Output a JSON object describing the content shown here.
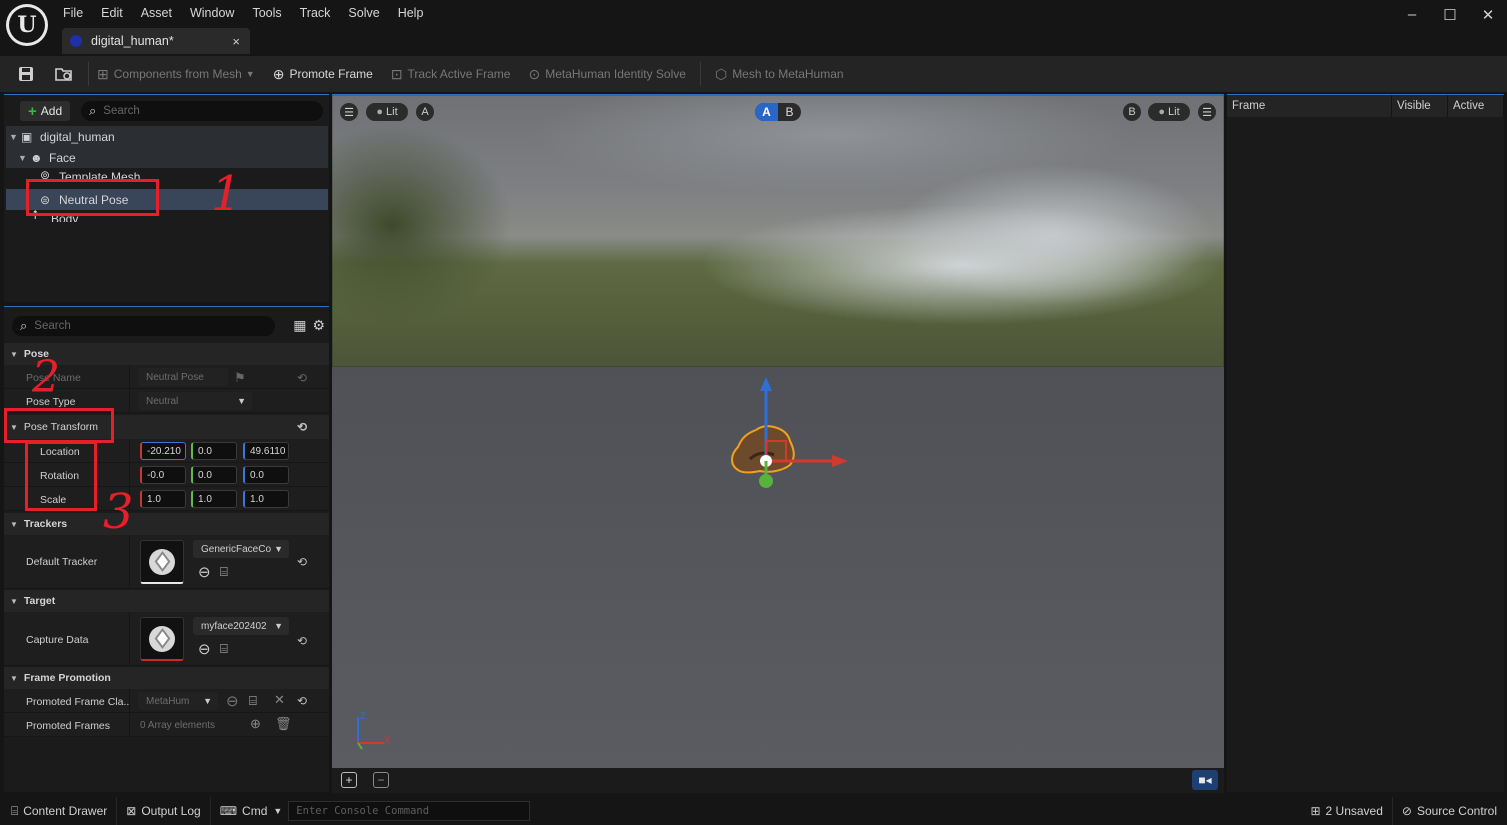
{
  "app": {
    "logo": "U",
    "menu": [
      "File",
      "Edit",
      "Asset",
      "Window",
      "Tools",
      "Track",
      "Solve",
      "Help"
    ],
    "tab_title": "digital_human*",
    "tab_close": "×",
    "window_controls": [
      "–",
      "☐",
      "✕"
    ]
  },
  "toolbar": {
    "save_icon": "save-icon",
    "browse_icon": "browse-icon",
    "buttons": [
      {
        "label": "Components from Mesh",
        "enabled": false,
        "icon": "components-icon"
      },
      {
        "label": "Promote Frame",
        "enabled": true,
        "icon": "plus-square-icon"
      },
      {
        "label": "Track Active Frame",
        "enabled": false,
        "icon": "track-icon"
      },
      {
        "label": "MetaHuman Identity Solve",
        "enabled": false,
        "icon": "solve-icon"
      },
      {
        "label": "Mesh to MetaHuman",
        "enabled": false,
        "icon": "cube-icon"
      }
    ]
  },
  "components": {
    "add_label": "Add",
    "search_placeholder": "Search",
    "tree": [
      "digital_human",
      "Face",
      "Template Mesh",
      "Neutral Pose",
      "Body"
    ]
  },
  "details": {
    "search_placeholder": "Search",
    "sections": {
      "pose": "Pose",
      "pose_transform": "Pose Transform",
      "trackers": "Trackers",
      "target": "Target",
      "frame_promotion": "Frame Promotion"
    },
    "pose_name_label": "Pose Name",
    "pose_name_value": "Neutral Pose",
    "pose_type_label": "Pose Type",
    "pose_type_value": "Neutral",
    "location_label": "Location",
    "location": [
      "-20.210",
      "0.0",
      "49.6110"
    ],
    "rotation_label": "Rotation",
    "rotation": [
      "-0.0",
      "0.0",
      "0.0"
    ],
    "scale_label": "Scale",
    "scale": [
      "1.0",
      "1.0",
      "1.0"
    ],
    "default_tracker_label": "Default Tracker",
    "default_tracker_value": "GenericFaceCo",
    "capture_data_label": "Capture Data",
    "capture_data_value": "myface202402",
    "promoted_frame_class_label": "Promoted Frame Cla..",
    "promoted_frame_class_value": "MetaHum",
    "promoted_frames_label": "Promoted Frames",
    "promoted_frames_value": "0 Array elements"
  },
  "viewport": {
    "left_view_mode": "Lit",
    "left_view_letter": "A",
    "toggle_a": "A",
    "toggle_b": "B",
    "right_view_letter": "B",
    "right_view_mode": "Lit",
    "axis_z": "Z",
    "axis_x": "X"
  },
  "frames_panel": {
    "columns": [
      "Frame",
      "Visible",
      "Active"
    ]
  },
  "statusbar": {
    "content_drawer": "Content Drawer",
    "output_log": "Output Log",
    "cmd": "Cmd",
    "console_placeholder": "Enter Console Command",
    "unsaved": "2 Unsaved",
    "source_control": "Source Control"
  },
  "annotations": [
    "1",
    "2",
    "3"
  ],
  "colors": {
    "accent_blue": "#2966c9",
    "selection": "#39465a",
    "annotation_red": "#e5202a",
    "gizmo_x": "#d33a2c",
    "gizmo_y": "#57b33a",
    "gizmo_z": "#2f6fd6"
  }
}
